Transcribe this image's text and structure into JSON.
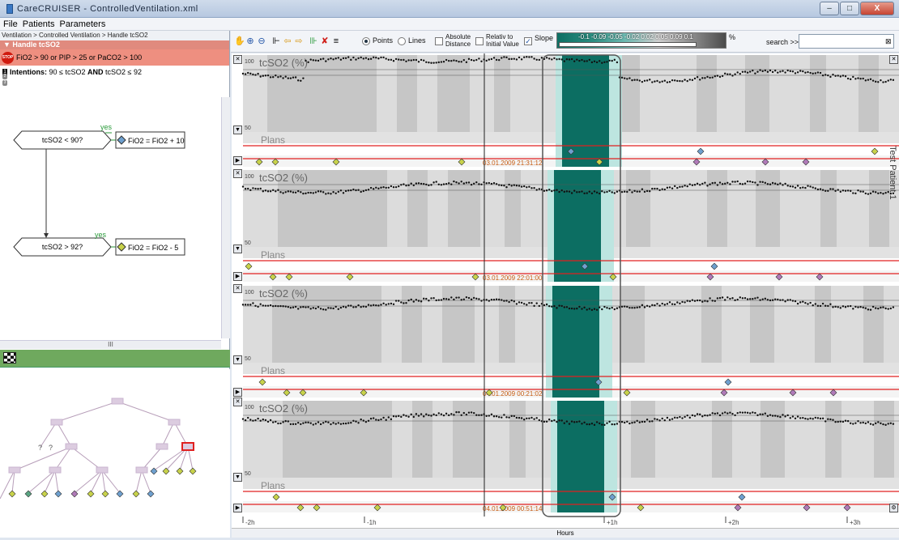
{
  "app": {
    "title": "CareCRUISER - ControlledVentilation.xml",
    "win_min": "–",
    "win_max": "□",
    "win_close": "X"
  },
  "menu": [
    "File",
    "Patients",
    "Parameters"
  ],
  "left": {
    "breadcrumb": "Ventilation > Controlled Ventilation > Handle tcSO2",
    "plan_header": "Handle tcSO2",
    "stop_icon_label": "STOP",
    "stop_condition": "FiO2 > 90 or PIP > 25 or PaCO2 > 100",
    "intentions_num": "1",
    "intentions_label": "Intentions:",
    "intentions_a": "90 ≤ tcSO2",
    "intentions_and": "AND",
    "intentions_b": "tcSO2 ≤ 92",
    "small_nums": [
      "2",
      "3"
    ],
    "flow": {
      "cond1": "tcSO2 < 90?",
      "yes1": "yes",
      "action1": "FiO2 = FiO2 + 10",
      "cond2": "tcSO2 > 92?",
      "yes2": "yes",
      "action2": "FiO2 = FiO2 - 5"
    },
    "hscroll_label": "III",
    "tree_q": [
      "?",
      "?"
    ]
  },
  "toolbar": {
    "points_label": "Points",
    "lines_label": "Lines",
    "absolute_label_1": "Absolute",
    "absolute_label_2": "Distance",
    "relative_label_1": "Relativ to",
    "relative_label_2": "Initial Value",
    "slope_label": "Slope",
    "slope_checked": "✓",
    "legend_values": "-0.1 -0.09 -0.05 -0.02 0.02 0.05 0.09 0.1",
    "legend_unit": "%",
    "search_label": "search >>",
    "search_value": "",
    "search_clear": "⊠"
  },
  "panels": [
    {
      "title": "tcSO2 (%)",
      "y_top": "100",
      "y_bottom": "50",
      "plans": "Plans",
      "timestamp": "03.01.2009 21:31:12"
    },
    {
      "title": "tcSO2 (%)",
      "y_top": "100",
      "y_bottom": "50",
      "plans": "Plans",
      "timestamp": "03.01.2009 22:01:00"
    },
    {
      "title": "tcSO2 (%)",
      "y_top": "100",
      "y_bottom": "50",
      "plans": "Plans",
      "timestamp": "04.01.2009 00:21:02"
    },
    {
      "title": "tcSO2 (%)",
      "y_top": "100",
      "y_bottom": "50",
      "plans": "Plans",
      "timestamp": "04.01.2009 00:51:14"
    }
  ],
  "x_ticks": [
    "-2h",
    "-1h",
    "+1h",
    "+2h",
    "+3h"
  ],
  "x_axis_label": "Hours",
  "side_label": "Test Patient 1",
  "colors": {
    "highlight": "#0c6e62",
    "plans_line": "#e02020",
    "green_bar": "#6fa95e",
    "stop_bg": "#ee8f80"
  }
}
